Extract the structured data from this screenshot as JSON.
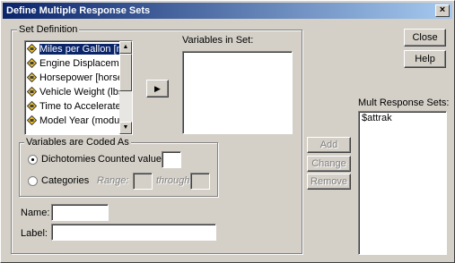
{
  "window": {
    "title": "Define Multiple Response Sets",
    "close_glyph": "×"
  },
  "set_definition": {
    "label": "Set Definition",
    "variables": [
      {
        "label": "Miles per Gallon [m",
        "selected": true
      },
      {
        "label": "Engine Displaceme",
        "selected": false
      },
      {
        "label": "Horsepower [horse]",
        "selected": false
      },
      {
        "label": "Vehicle Weight (lbs",
        "selected": false
      },
      {
        "label": "Time to Accelerate",
        "selected": false
      },
      {
        "label": "Model Year (modulo",
        "selected": false
      }
    ],
    "move_button_glyph": "▶",
    "variables_in_set_label": "Variables in Set:"
  },
  "coded_as": {
    "label": "Variables are Coded As",
    "dichotomies_label": "Dichotomies",
    "counted_value_label": "Counted value:",
    "counted_value": "",
    "categories_label": "Categories",
    "range_label": "Range:",
    "through_label": "through",
    "selected": "dichotomies"
  },
  "name_label": "Name:",
  "name_value": "",
  "label_label": "Label:",
  "label_value": "",
  "buttons": {
    "close": "Close",
    "help": "Help",
    "add": "Add",
    "change": "Change",
    "remove": "Remove"
  },
  "mult_response_sets": {
    "label": "Mult Response Sets:",
    "items": [
      "$attrak"
    ]
  }
}
